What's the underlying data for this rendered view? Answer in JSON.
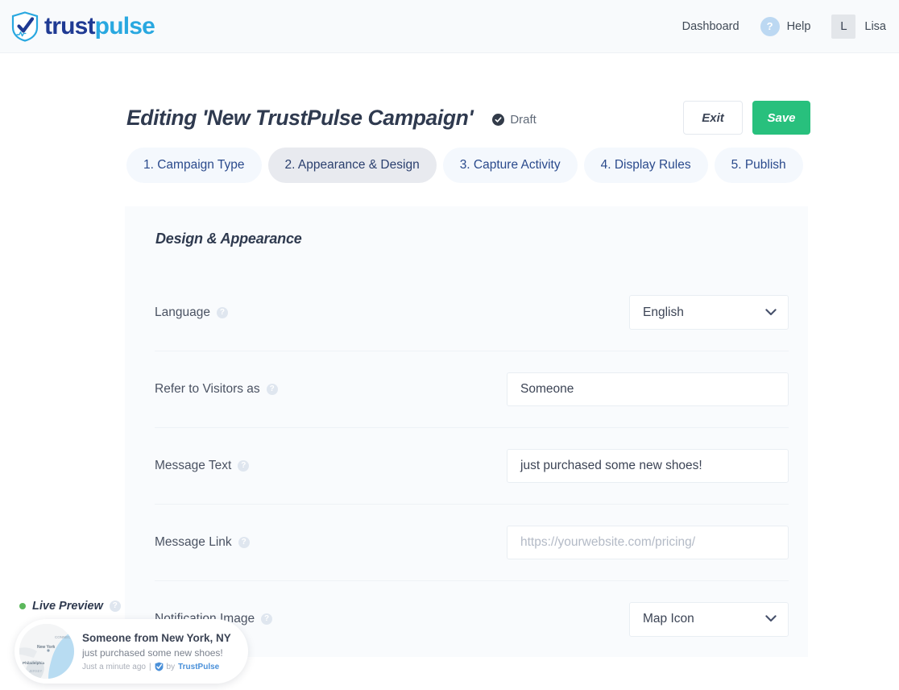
{
  "header": {
    "logo": {
      "part1": "trust",
      "part2": "pulse",
      "icon": "shield-check-icon"
    },
    "dashboard_label": "Dashboard",
    "help_label": "Help",
    "help_icon_glyph": "?",
    "user_initial": "L",
    "user_name": "Lisa"
  },
  "title_bar": {
    "title": "Editing 'New TrustPulse Campaign'",
    "status_label": "Draft",
    "status_icon": "check-circle-icon",
    "exit_label": "Exit",
    "save_label": "Save"
  },
  "tabs": [
    {
      "label": "1. Campaign Type",
      "active": false
    },
    {
      "label": "2. Appearance & Design",
      "active": true
    },
    {
      "label": "3. Capture Activity",
      "active": false
    },
    {
      "label": "4. Display Rules",
      "active": false
    },
    {
      "label": "5. Publish",
      "active": false
    }
  ],
  "card": {
    "title": "Design & Appearance",
    "help_glyph": "?",
    "rows": {
      "language": {
        "label": "Language",
        "value": "English"
      },
      "refer_to_visitors": {
        "label": "Refer to Visitors as",
        "value": "Someone"
      },
      "message_text": {
        "label": "Message Text",
        "value": "just purchased some new shoes!"
      },
      "message_link": {
        "label": "Message Link",
        "placeholder": "https://yourwebsite.com/pricing/"
      },
      "notification_image": {
        "label": "Notification Image",
        "value": "Map Icon"
      }
    }
  },
  "live_preview": {
    "label": "Live Preview",
    "help_glyph": "?",
    "notification": {
      "title": "Someone from New York, NY",
      "subtitle": "just purchased some new shoes!",
      "time": "Just a minute ago",
      "separator": "|",
      "brand_prefix": "by",
      "brand": "TrustPulse",
      "map_labels": [
        "CONNEC",
        "New York",
        "Philadelphia",
        "JERSEY"
      ]
    }
  },
  "colors": {
    "brand_blue": "#1f3a93",
    "brand_cyan": "#29a8e0",
    "save_green": "#28c07d",
    "tab_text": "#2a4a8c",
    "card_bg": "#f9fbfd"
  }
}
